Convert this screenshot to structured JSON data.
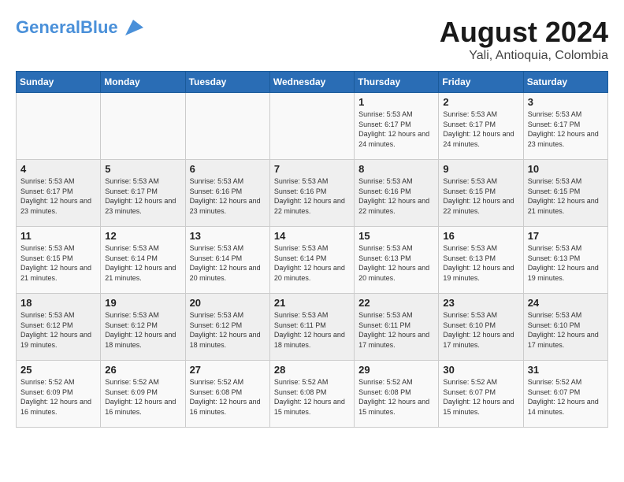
{
  "header": {
    "logo_text_general": "General",
    "logo_text_blue": "Blue",
    "month_year": "August 2024",
    "location": "Yali, Antioquia, Colombia"
  },
  "weekdays": [
    "Sunday",
    "Monday",
    "Tuesday",
    "Wednesday",
    "Thursday",
    "Friday",
    "Saturday"
  ],
  "weeks": [
    [
      {
        "day": "",
        "sunrise": "",
        "sunset": "",
        "daylight": ""
      },
      {
        "day": "",
        "sunrise": "",
        "sunset": "",
        "daylight": ""
      },
      {
        "day": "",
        "sunrise": "",
        "sunset": "",
        "daylight": ""
      },
      {
        "day": "",
        "sunrise": "",
        "sunset": "",
        "daylight": ""
      },
      {
        "day": "1",
        "sunrise": "Sunrise: 5:53 AM",
        "sunset": "Sunset: 6:17 PM",
        "daylight": "Daylight: 12 hours and 24 minutes."
      },
      {
        "day": "2",
        "sunrise": "Sunrise: 5:53 AM",
        "sunset": "Sunset: 6:17 PM",
        "daylight": "Daylight: 12 hours and 24 minutes."
      },
      {
        "day": "3",
        "sunrise": "Sunrise: 5:53 AM",
        "sunset": "Sunset: 6:17 PM",
        "daylight": "Daylight: 12 hours and 23 minutes."
      }
    ],
    [
      {
        "day": "4",
        "sunrise": "Sunrise: 5:53 AM",
        "sunset": "Sunset: 6:17 PM",
        "daylight": "Daylight: 12 hours and 23 minutes."
      },
      {
        "day": "5",
        "sunrise": "Sunrise: 5:53 AM",
        "sunset": "Sunset: 6:17 PM",
        "daylight": "Daylight: 12 hours and 23 minutes."
      },
      {
        "day": "6",
        "sunrise": "Sunrise: 5:53 AM",
        "sunset": "Sunset: 6:16 PM",
        "daylight": "Daylight: 12 hours and 23 minutes."
      },
      {
        "day": "7",
        "sunrise": "Sunrise: 5:53 AM",
        "sunset": "Sunset: 6:16 PM",
        "daylight": "Daylight: 12 hours and 22 minutes."
      },
      {
        "day": "8",
        "sunrise": "Sunrise: 5:53 AM",
        "sunset": "Sunset: 6:16 PM",
        "daylight": "Daylight: 12 hours and 22 minutes."
      },
      {
        "day": "9",
        "sunrise": "Sunrise: 5:53 AM",
        "sunset": "Sunset: 6:15 PM",
        "daylight": "Daylight: 12 hours and 22 minutes."
      },
      {
        "day": "10",
        "sunrise": "Sunrise: 5:53 AM",
        "sunset": "Sunset: 6:15 PM",
        "daylight": "Daylight: 12 hours and 21 minutes."
      }
    ],
    [
      {
        "day": "11",
        "sunrise": "Sunrise: 5:53 AM",
        "sunset": "Sunset: 6:15 PM",
        "daylight": "Daylight: 12 hours and 21 minutes."
      },
      {
        "day": "12",
        "sunrise": "Sunrise: 5:53 AM",
        "sunset": "Sunset: 6:14 PM",
        "daylight": "Daylight: 12 hours and 21 minutes."
      },
      {
        "day": "13",
        "sunrise": "Sunrise: 5:53 AM",
        "sunset": "Sunset: 6:14 PM",
        "daylight": "Daylight: 12 hours and 20 minutes."
      },
      {
        "day": "14",
        "sunrise": "Sunrise: 5:53 AM",
        "sunset": "Sunset: 6:14 PM",
        "daylight": "Daylight: 12 hours and 20 minutes."
      },
      {
        "day": "15",
        "sunrise": "Sunrise: 5:53 AM",
        "sunset": "Sunset: 6:13 PM",
        "daylight": "Daylight: 12 hours and 20 minutes."
      },
      {
        "day": "16",
        "sunrise": "Sunrise: 5:53 AM",
        "sunset": "Sunset: 6:13 PM",
        "daylight": "Daylight: 12 hours and 19 minutes."
      },
      {
        "day": "17",
        "sunrise": "Sunrise: 5:53 AM",
        "sunset": "Sunset: 6:13 PM",
        "daylight": "Daylight: 12 hours and 19 minutes."
      }
    ],
    [
      {
        "day": "18",
        "sunrise": "Sunrise: 5:53 AM",
        "sunset": "Sunset: 6:12 PM",
        "daylight": "Daylight: 12 hours and 19 minutes."
      },
      {
        "day": "19",
        "sunrise": "Sunrise: 5:53 AM",
        "sunset": "Sunset: 6:12 PM",
        "daylight": "Daylight: 12 hours and 18 minutes."
      },
      {
        "day": "20",
        "sunrise": "Sunrise: 5:53 AM",
        "sunset": "Sunset: 6:12 PM",
        "daylight": "Daylight: 12 hours and 18 minutes."
      },
      {
        "day": "21",
        "sunrise": "Sunrise: 5:53 AM",
        "sunset": "Sunset: 6:11 PM",
        "daylight": "Daylight: 12 hours and 18 minutes."
      },
      {
        "day": "22",
        "sunrise": "Sunrise: 5:53 AM",
        "sunset": "Sunset: 6:11 PM",
        "daylight": "Daylight: 12 hours and 17 minutes."
      },
      {
        "day": "23",
        "sunrise": "Sunrise: 5:53 AM",
        "sunset": "Sunset: 6:10 PM",
        "daylight": "Daylight: 12 hours and 17 minutes."
      },
      {
        "day": "24",
        "sunrise": "Sunrise: 5:53 AM",
        "sunset": "Sunset: 6:10 PM",
        "daylight": "Daylight: 12 hours and 17 minutes."
      }
    ],
    [
      {
        "day": "25",
        "sunrise": "Sunrise: 5:52 AM",
        "sunset": "Sunset: 6:09 PM",
        "daylight": "Daylight: 12 hours and 16 minutes."
      },
      {
        "day": "26",
        "sunrise": "Sunrise: 5:52 AM",
        "sunset": "Sunset: 6:09 PM",
        "daylight": "Daylight: 12 hours and 16 minutes."
      },
      {
        "day": "27",
        "sunrise": "Sunrise: 5:52 AM",
        "sunset": "Sunset: 6:08 PM",
        "daylight": "Daylight: 12 hours and 16 minutes."
      },
      {
        "day": "28",
        "sunrise": "Sunrise: 5:52 AM",
        "sunset": "Sunset: 6:08 PM",
        "daylight": "Daylight: 12 hours and 15 minutes."
      },
      {
        "day": "29",
        "sunrise": "Sunrise: 5:52 AM",
        "sunset": "Sunset: 6:08 PM",
        "daylight": "Daylight: 12 hours and 15 minutes."
      },
      {
        "day": "30",
        "sunrise": "Sunrise: 5:52 AM",
        "sunset": "Sunset: 6:07 PM",
        "daylight": "Daylight: 12 hours and 15 minutes."
      },
      {
        "day": "31",
        "sunrise": "Sunrise: 5:52 AM",
        "sunset": "Sunset: 6:07 PM",
        "daylight": "Daylight: 12 hours and 14 minutes."
      }
    ]
  ]
}
